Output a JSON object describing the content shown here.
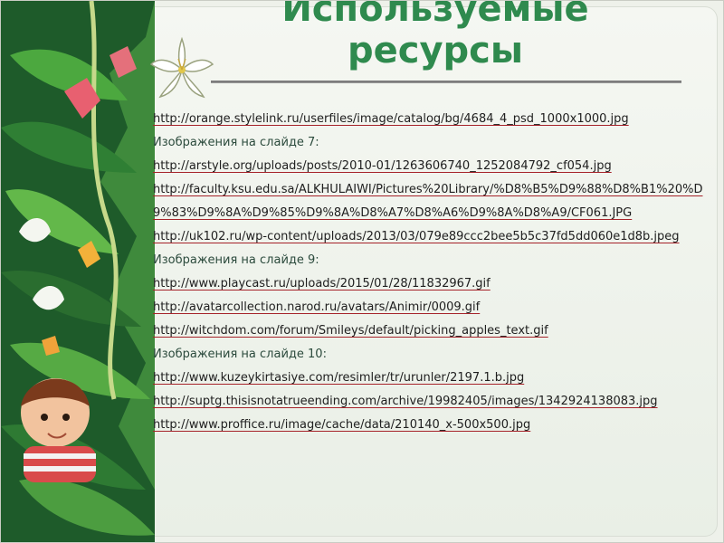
{
  "slide": {
    "title_line1": "Используемые",
    "title_line2": "ресурсы",
    "items": [
      {
        "type": "link",
        "text": "http://orange.stylelink.ru/userfiles/image/catalog/bg/4684_4_psd_1000x1000.jpg"
      },
      {
        "type": "heading",
        "text": "Изображения на слайде 7:"
      },
      {
        "type": "link",
        "text": "http://arstyle.org/uploads/posts/2010-01/1263606740_1252084792_cf054.jpg"
      },
      {
        "type": "link",
        "text": "http://faculty.ksu.edu.sa/ALKHULAIWI/Pictures%20Library/%D8%B5%D9%88%D8%B1%20%D9%83%D9%8A%D9%85%D9%8A%D8%A7%D8%A6%D9%8A%D8%A9/CF061.JPG"
      },
      {
        "type": "link",
        "text": "http://uk102.ru/wp-content/uploads/2013/03/079e89ccc2bee5b5c37fd5dd060e1d8b.jpeg"
      },
      {
        "type": "heading",
        "text": "Изображения на слайде 9:"
      },
      {
        "type": "link",
        "text": "http://www.playcast.ru/uploads/2015/01/28/11832967.gif"
      },
      {
        "type": "link",
        "text": "http://avatarcollection.narod.ru/avatars/Animir/0009.gif"
      },
      {
        "type": "link",
        "text": "http://witchdom.com/forum/Smileys/default/picking_apples_text.gif"
      },
      {
        "type": "heading",
        "text": "Изображения на слайде 10:"
      },
      {
        "type": "link",
        "text": "http://www.kuzeykirtasiye.com/resimler/tr/urunler/2197.1.b.jpg"
      },
      {
        "type": "link",
        "text": "http://suptg.thisisnotatrueending.com/archive/19982405/images/1342924138083.jpg"
      },
      {
        "type": "link",
        "text": "http://www.proffice.ru/image/cache/data/210140_x-500x500.jpg"
      }
    ]
  },
  "colors": {
    "title": "#2f8a4e",
    "link_underline": "#a6232a"
  }
}
